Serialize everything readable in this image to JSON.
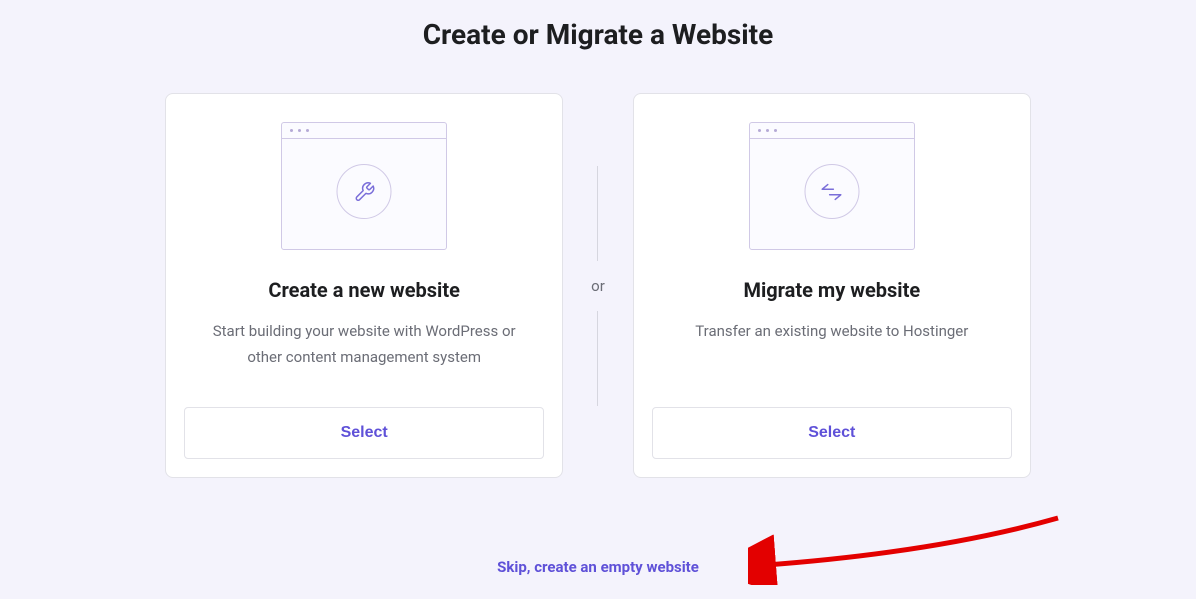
{
  "page": {
    "title": "Create or Migrate a Website",
    "divider_label": "or",
    "skip_link": "Skip, create an empty website"
  },
  "cards": {
    "create": {
      "title": "Create a new website",
      "description": "Start building your website with WordPress or other content management system",
      "button_label": "Select",
      "icon": "wrench"
    },
    "migrate": {
      "title": "Migrate my website",
      "description": "Transfer an existing website to Hostinger",
      "button_label": "Select",
      "icon": "transfer-arrows"
    }
  },
  "colors": {
    "accent": "#5f51d8",
    "background": "#f4f3fc",
    "text_primary": "#1d1e20",
    "text_secondary": "#6b6d76",
    "border": "#e2e2e8",
    "annotation": "#e30000"
  }
}
